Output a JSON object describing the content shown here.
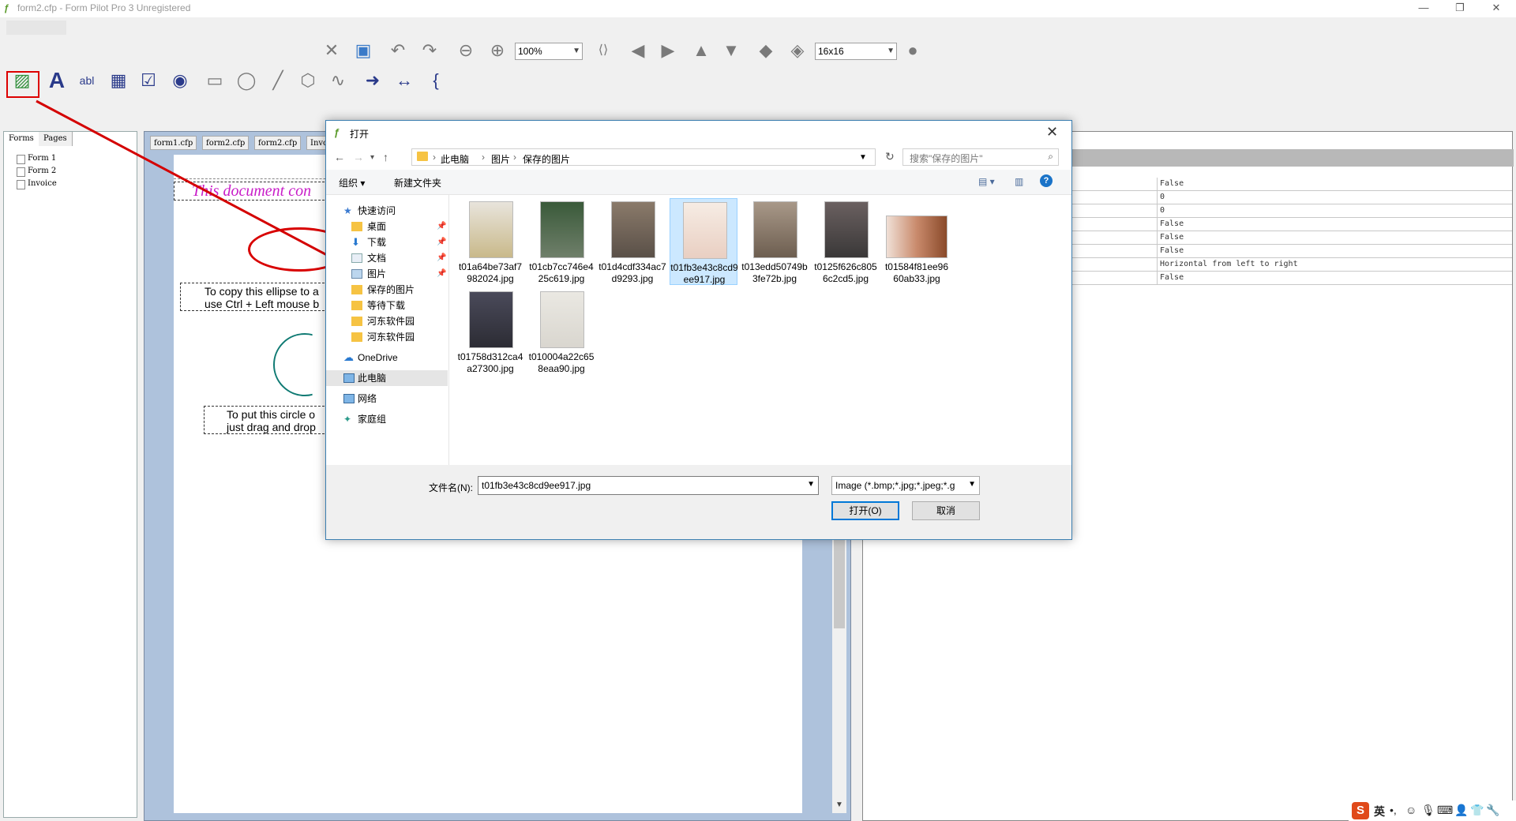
{
  "window": {
    "title": "form2.cfp - Form Pilot Pro 3 Unregistered",
    "minimize": "—",
    "restore": "❐",
    "close": "✕"
  },
  "toolbar": {
    "zoom_value": "100%",
    "icon_size_value": "16x16"
  },
  "left_panel": {
    "tabs": [
      "Forms",
      "Pages"
    ],
    "items": [
      "Form 1",
      "Form 2",
      "Invoice"
    ]
  },
  "doc_tabs": [
    "form1.cfp",
    "form2.cfp",
    "form2.cfp",
    "Invo"
  ],
  "page": {
    "heading": "This document con",
    "text1_line1": "To copy this ellipse to a",
    "text1_line2": "use Ctrl + Left mouse b",
    "text2_line1": "To put this circle o",
    "text2_line2": "just drag and drop"
  },
  "properties": {
    "values": [
      "False",
      "0",
      "0",
      "False",
      "False",
      "False",
      "Horizontal from left to right",
      "False"
    ]
  },
  "dialog": {
    "title": "打开",
    "address": {
      "crumbs": [
        "此电脑",
        "图片",
        "保存的图片"
      ]
    },
    "search_placeholder": "搜索\"保存的图片\"",
    "commands": {
      "organize": "组织 ▾",
      "new_folder": "新建文件夹"
    },
    "nav": {
      "quick_access": "快速访问",
      "desktop": "桌面",
      "downloads": "下载",
      "documents": "文档",
      "pictures": "图片",
      "saved_pictures": "保存的图片",
      "pending_downloads": "等待下载",
      "hedong1": "河东软件园",
      "hedong2": "河东软件园",
      "onedrive": "OneDrive",
      "this_pc": "此电脑",
      "network": "网络",
      "homegroup": "家庭组"
    },
    "files": [
      {
        "name": "t01a64be73af7982024.jpg",
        "color": "#c9b98a"
      },
      {
        "name": "t01cb7cc746e425c619.jpg",
        "color": "#6f7f6a"
      },
      {
        "name": "t01d4cdf334ac7d9293.jpg",
        "color": "#5a5048"
      },
      {
        "name": "t01fb3e43c8cd9ee917.jpg",
        "color": "#e9cfc2"
      },
      {
        "name": "t013edd50749b3fe72b.jpg",
        "color": "#6d5e50"
      },
      {
        "name": "t0125f626c8056c2cd5.jpg",
        "color": "#3a3838"
      },
      {
        "name": "t01584f81ee9660ab33.jpg",
        "color": "#c98a6c"
      },
      {
        "name": "t01758d312ca4a27300.jpg",
        "color": "#2c2c34"
      },
      {
        "name": "t010004a22c658eaa90.jpg",
        "color": "#d9d6cf"
      }
    ],
    "filename_label": "文件名(N):",
    "filename_value": "t01fb3e43c8cd9ee917.jpg",
    "filetype_value": "Image (*.bmp;*.jpg;*.jpeg;*.g",
    "open_button": "打开(O)",
    "cancel_button": "取消"
  },
  "tray": {
    "ime_lang": "英",
    "punct": "•,"
  }
}
